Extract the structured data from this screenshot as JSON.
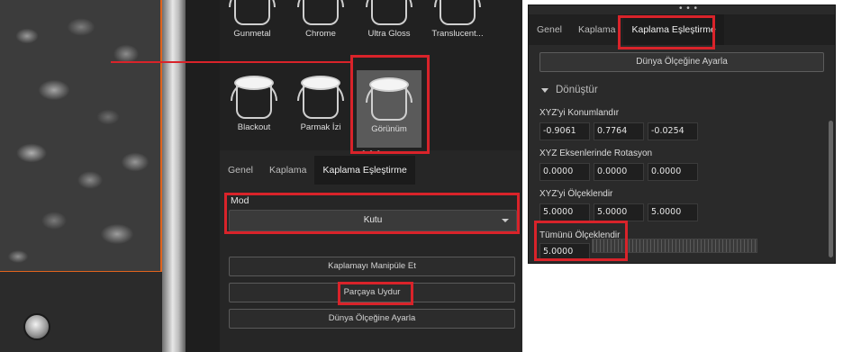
{
  "materials_row1": [
    {
      "label": "Gunmetal",
      "icon": "paint-bucket-icon"
    },
    {
      "label": "Chrome",
      "icon": "paint-bucket-icon"
    },
    {
      "label": "Ultra Gloss",
      "icon": "paint-bucket-icon"
    },
    {
      "label": "Translucent...",
      "icon": "paint-bucket-icon"
    }
  ],
  "materials_row2": [
    {
      "label": "Blackout",
      "icon": "paint-bucket-icon"
    },
    {
      "label": "Parmak İzi",
      "icon": "paint-bucket-icon"
    },
    {
      "label": "Görünüm",
      "icon": "paint-bucket-icon",
      "selected": true
    }
  ],
  "splitter_dots": "• • •",
  "left_tabs": [
    {
      "label": "Genel"
    },
    {
      "label": "Kaplama"
    },
    {
      "label": "Kaplama Eşleştirme",
      "active": true
    }
  ],
  "mode": {
    "label": "Mod",
    "value": "Kutu"
  },
  "buttons": {
    "manipulate": "Kaplamayı Manipüle Et",
    "fit_part": "Parçaya Uydur",
    "world_scale": "Dünya Ölçeğine Ayarla"
  },
  "right_panel": {
    "tabs": [
      {
        "label": "Genel"
      },
      {
        "label": "Kaplama"
      },
      {
        "label": "Kaplama Eşleştirme",
        "active": true
      }
    ],
    "world_scale_button": "Dünya Ölçeğine Ayarla",
    "section_title": "Dönüştür",
    "position": {
      "label": "XYZ'yi Konumlandır",
      "values": [
        "-0.9061",
        "0.7764",
        "-0.0254"
      ]
    },
    "rotation": {
      "label": "XYZ Eksenlerinde Rotasyon",
      "values": [
        "0.0000",
        "0.0000",
        "0.0000"
      ]
    },
    "scale": {
      "label": "XYZ'yi Ölçeklendir",
      "values": [
        "5.0000",
        "5.0000",
        "5.0000"
      ]
    },
    "uniform_scale": {
      "label": "Tümünü Ölçeklendir",
      "value": "5.0000"
    }
  },
  "colors": {
    "highlight": "#d9232a",
    "model_edge": "#e2641d",
    "panel_bg": "#262626"
  }
}
